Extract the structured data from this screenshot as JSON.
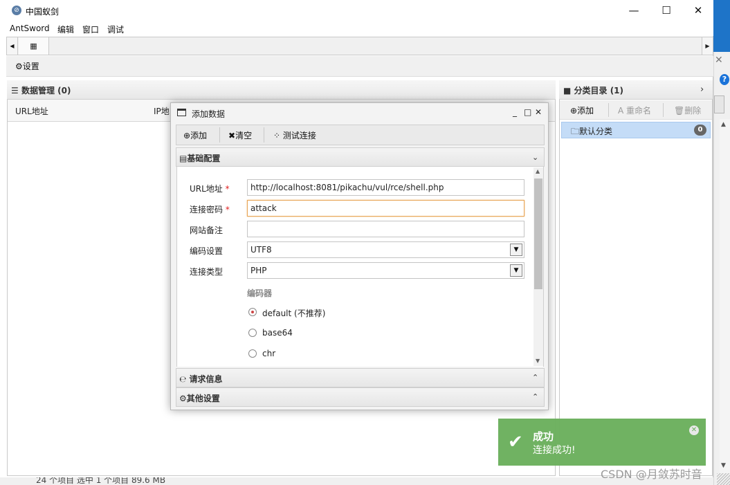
{
  "window": {
    "title": "中国蚁剑",
    "icon": "antsword-logo-icon"
  },
  "menu": [
    "AntSword",
    "编辑",
    "窗口",
    "调试"
  ],
  "toolbar": {
    "settings": "设置"
  },
  "data_panel": {
    "title": "数据管理 (0)",
    "columns": [
      "URL地址",
      "IP地"
    ]
  },
  "category_panel": {
    "title": "分类目录 (1)",
    "buttons": {
      "add": "添加",
      "rename": "重命名",
      "delete": "删除"
    },
    "item": {
      "label": "默认分类",
      "count": "0"
    }
  },
  "dialog": {
    "title": "添加数据",
    "toolbar": {
      "add": "添加",
      "clear": "清空",
      "test": "测试连接"
    },
    "sections": {
      "basic": "基础配置",
      "request": "请求信息",
      "other": "其他设置"
    },
    "form": {
      "url_label": "URL地址",
      "url_value": "http://localhost:8081/pikachu/vul/rce/shell.php",
      "pwd_label": "连接密码",
      "pwd_value": "attack",
      "note_label": "网站备注",
      "note_value": "",
      "encoding_label": "编码设置",
      "encoding_value": "UTF8",
      "type_label": "连接类型",
      "type_value": "PHP",
      "encoder_label": "编码器",
      "encoders": [
        "default (不推荐)",
        "base64",
        "chr"
      ],
      "selected_encoder": "default (不推荐)"
    }
  },
  "toast": {
    "title": "成功",
    "message": "连接成功!"
  },
  "status_bar": {
    "text": "24 个项目    选中 1 个项目  89.6 MB"
  },
  "watermark": "CSDN @月敛苏时音",
  "colors": {
    "toast_bg": "#6aaf5c",
    "selected_item": "#c4dcf7",
    "focus_border": "#e8a455",
    "required": "#e02020"
  }
}
